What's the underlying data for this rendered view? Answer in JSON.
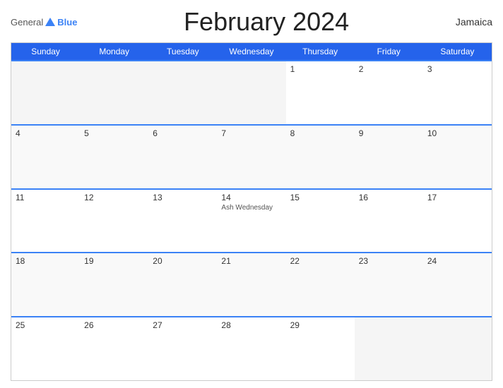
{
  "header": {
    "logo": {
      "general": "General",
      "triangle": "▲",
      "blue": "Blue"
    },
    "title": "February 2024",
    "country": "Jamaica"
  },
  "calendar": {
    "day_headers": [
      "Sunday",
      "Monday",
      "Tuesday",
      "Wednesday",
      "Thursday",
      "Friday",
      "Saturday"
    ],
    "weeks": [
      [
        {
          "day": "",
          "event": ""
        },
        {
          "day": "",
          "event": ""
        },
        {
          "day": "",
          "event": ""
        },
        {
          "day": "",
          "event": ""
        },
        {
          "day": "1",
          "event": ""
        },
        {
          "day": "2",
          "event": ""
        },
        {
          "day": "3",
          "event": ""
        }
      ],
      [
        {
          "day": "4",
          "event": ""
        },
        {
          "day": "5",
          "event": ""
        },
        {
          "day": "6",
          "event": ""
        },
        {
          "day": "7",
          "event": ""
        },
        {
          "day": "8",
          "event": ""
        },
        {
          "day": "9",
          "event": ""
        },
        {
          "day": "10",
          "event": ""
        }
      ],
      [
        {
          "day": "11",
          "event": ""
        },
        {
          "day": "12",
          "event": ""
        },
        {
          "day": "13",
          "event": ""
        },
        {
          "day": "14",
          "event": "Ash Wednesday"
        },
        {
          "day": "15",
          "event": ""
        },
        {
          "day": "16",
          "event": ""
        },
        {
          "day": "17",
          "event": ""
        }
      ],
      [
        {
          "day": "18",
          "event": ""
        },
        {
          "day": "19",
          "event": ""
        },
        {
          "day": "20",
          "event": ""
        },
        {
          "day": "21",
          "event": ""
        },
        {
          "day": "22",
          "event": ""
        },
        {
          "day": "23",
          "event": ""
        },
        {
          "day": "24",
          "event": ""
        }
      ],
      [
        {
          "day": "25",
          "event": ""
        },
        {
          "day": "26",
          "event": ""
        },
        {
          "day": "27",
          "event": ""
        },
        {
          "day": "28",
          "event": ""
        },
        {
          "day": "29",
          "event": ""
        },
        {
          "day": "",
          "event": ""
        },
        {
          "day": "",
          "event": ""
        }
      ]
    ]
  }
}
